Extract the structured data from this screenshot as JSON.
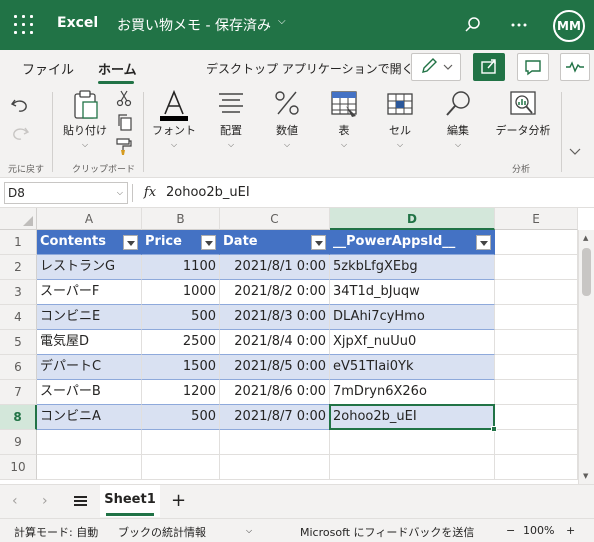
{
  "titlebar": {
    "app_name": "Excel",
    "doc_title": "お買い物メモ - 保存済み",
    "doc_chevron": "⌵",
    "avatar_initials": "MM",
    "accent": "#217346"
  },
  "ribbon_tabs": {
    "file": "ファイル",
    "home": "ホーム",
    "open_desktop": "デスクトップ アプリケーションで開く"
  },
  "ribbon": {
    "undo_group": "元に戻す",
    "clipboard_group": "クリップボード",
    "paste": "貼り付け",
    "font": "フォント",
    "alignment": "配置",
    "number": "数値",
    "table": "表",
    "cells": "セル",
    "editing": "編集",
    "analysis": "データ分析",
    "analysis_group": "分析"
  },
  "formula_bar": {
    "name_box": "D8",
    "fx": "fx",
    "value": "2ohoo2b_uEI"
  },
  "grid": {
    "columns": [
      "A",
      "B",
      "C",
      "D",
      "E"
    ],
    "rows": [
      "1",
      "2",
      "3",
      "4",
      "5",
      "6",
      "7",
      "8",
      "9",
      "10"
    ],
    "header": [
      "Contents",
      "Price",
      "Date",
      "__PowerAppsId__"
    ],
    "data": [
      [
        "レストランG",
        "1100",
        "2021/8/1 0:00",
        "5zkbLfgXEbg"
      ],
      [
        "スーパーF",
        "1000",
        "2021/8/2 0:00",
        "34T1d_bJuqw"
      ],
      [
        "コンビニE",
        "500",
        "2021/8/3 0:00",
        "DLAhi7cyHmo"
      ],
      [
        "電気屋D",
        "2500",
        "2021/8/4 0:00",
        "XjpXf_nuUu0"
      ],
      [
        "デパートC",
        "1500",
        "2021/8/5 0:00",
        "eV51TIai0Yk"
      ],
      [
        "スーパーB",
        "1200",
        "2021/8/6 0:00",
        "7mDryn6X26o"
      ],
      [
        "コンビニA",
        "500",
        "2021/8/7 0:00",
        "2ohoo2b_uEI"
      ]
    ],
    "active_cell": "D8",
    "table_header_color": "#4472c4",
    "table_band_color": "#d9e1f2"
  },
  "sheets": {
    "active": "Sheet1",
    "add": "+",
    "prev": "‹",
    "next": "›"
  },
  "statusbar": {
    "calc_mode": "計算モード: 自動",
    "workbook_stats": "ブックの統計情報",
    "feedback": "Microsoft にフィードバックを送信",
    "zoom_out": "−",
    "zoom": "100%",
    "zoom_in": "+"
  }
}
